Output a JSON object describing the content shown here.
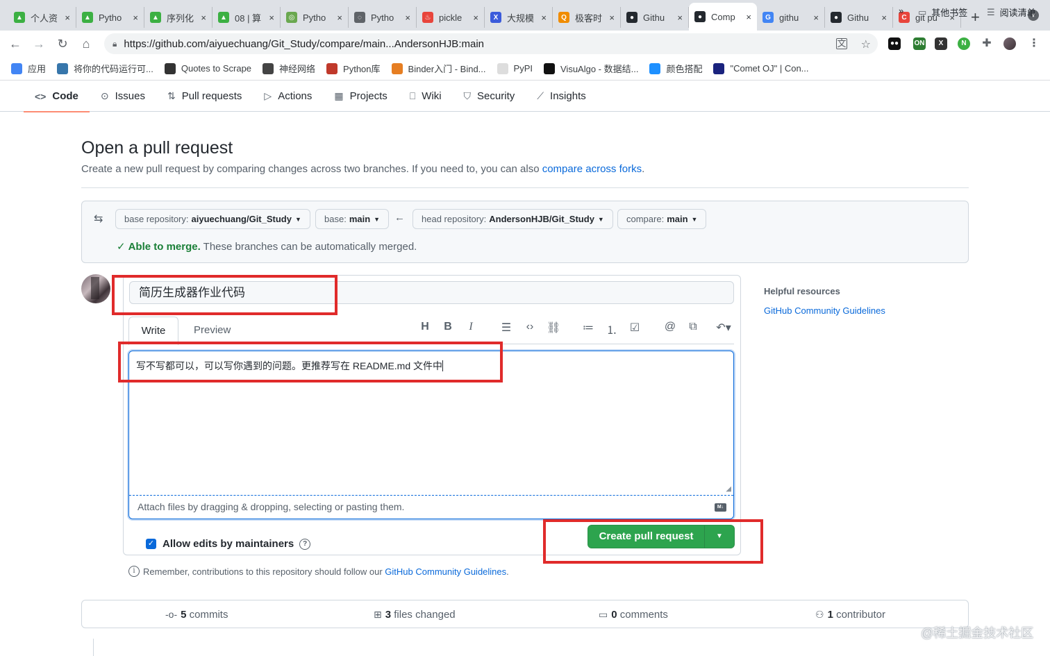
{
  "browser": {
    "tabs": [
      {
        "label": "个人资",
        "color": "#3cb043",
        "glyph": "▲"
      },
      {
        "label": "Pytho",
        "color": "#3cb043",
        "glyph": "▲"
      },
      {
        "label": "序列化",
        "color": "#3cb043",
        "glyph": "▲"
      },
      {
        "label": "08 | 算",
        "color": "#3cb043",
        "glyph": "▲"
      },
      {
        "label": "Pytho",
        "color": "#6aa84f",
        "glyph": "◎"
      },
      {
        "label": "Pytho",
        "color": "#5f6368",
        "glyph": "◌"
      },
      {
        "label": "pickle",
        "color": "#e8453c",
        "glyph": "♨"
      },
      {
        "label": "大规模",
        "color": "#3b5bdb",
        "glyph": "X"
      },
      {
        "label": "极客时",
        "color": "#f08c00",
        "glyph": "Q"
      },
      {
        "label": "Githu",
        "color": "#24292f",
        "glyph": "●"
      },
      {
        "label": "Comp",
        "color": "#24292f",
        "glyph": "●"
      },
      {
        "label": "githu",
        "color": "#4285f4",
        "glyph": "G"
      },
      {
        "label": "Githu",
        "color": "#24292f",
        "glyph": "●"
      },
      {
        "label": "git pu",
        "color": "#e8453c",
        "glyph": "C"
      }
    ],
    "active_tab_index": 10,
    "tab_close": "×",
    "new_tab": "+",
    "url_main": "https://github.com/aiyuechuang/Git_Study/compare/main...AndersonHJB:main",
    "bookmarks": [
      {
        "label": "应用",
        "color": "#4285f4"
      },
      {
        "label": "将你的代码运行可...",
        "color": "#3776ab"
      },
      {
        "label": "Quotes to Scrape",
        "color": "#333333"
      },
      {
        "label": "神经网络",
        "color": "#444444"
      },
      {
        "label": "Python库",
        "color": "#c0392b"
      },
      {
        "label": "Binder入门 - Bind...",
        "color": "#e67e22"
      },
      {
        "label": "PyPI",
        "color": "#dddddd"
      },
      {
        "label": "VisuAlgo - 数据结...",
        "color": "#111111"
      },
      {
        "label": "颜色搭配",
        "color": "#1e90ff"
      },
      {
        "label": "\"Comet OJ\" | Con...",
        "color": "#1a237e"
      }
    ],
    "bookmarks_more": "»",
    "other_bookmarks": "其他书签",
    "reading_list": "阅读清单"
  },
  "repo_nav": [
    {
      "label": "Code",
      "icon": "code-icon",
      "glyph": "<>",
      "selected": true
    },
    {
      "label": "Issues",
      "icon": "issue-icon",
      "glyph": "⊙",
      "selected": false
    },
    {
      "label": "Pull requests",
      "icon": "pull-request-icon",
      "glyph": "⇅",
      "selected": false
    },
    {
      "label": "Actions",
      "icon": "actions-icon",
      "glyph": "▷",
      "selected": false
    },
    {
      "label": "Projects",
      "icon": "projects-icon",
      "glyph": "▦",
      "selected": false
    },
    {
      "label": "Wiki",
      "icon": "wiki-icon",
      "glyph": "⎕",
      "selected": false
    },
    {
      "label": "Security",
      "icon": "shield-icon",
      "glyph": "⛉",
      "selected": false
    },
    {
      "label": "Insights",
      "icon": "graph-icon",
      "glyph": "⟋",
      "selected": false
    }
  ],
  "page": {
    "title": "Open a pull request",
    "subtitle_prefix": "Create a new pull request by comparing changes across two branches. If you need to, you can also ",
    "subtitle_link": "compare across forks",
    "subtitle_suffix": "."
  },
  "range": {
    "base_repo_label": "base repository:",
    "base_repo_value": "aiyuechuang/Git_Study",
    "base_label": "base:",
    "base_value": "main",
    "head_repo_label": "head repository:",
    "head_repo_value": "AndersonHJB/Git_Study",
    "compare_label": "compare:",
    "compare_value": "main",
    "merge_status": "Able to merge.",
    "merge_detail": "These branches can be automatically merged."
  },
  "form": {
    "title_value": "简历生成器作业代码",
    "tab_write": "Write",
    "tab_preview": "Preview",
    "body_value": "写不写都可以，可以写你遇到的问题。更推荐写在 README.md 文件中",
    "attach_hint": "Attach files by dragging & dropping, selecting or pasting them.",
    "allow_edits": "Allow edits by maintainers",
    "create_button": "Create pull request",
    "remember_prefix": "Remember, contributions to this repository should follow our ",
    "remember_link": "GitHub Community Guidelines",
    "remember_suffix": "."
  },
  "sidebar": {
    "heading": "Helpful resources",
    "link": "GitHub Community Guidelines"
  },
  "stats": {
    "commits_count": "5",
    "commits_label": "commits",
    "files_count": "3",
    "files_label": "files changed",
    "comments_count": "0",
    "comments_label": "comments",
    "contributors_count": "1",
    "contributors_label": "contributor"
  },
  "watermark": "@稀土掘金技术社区",
  "annotation_color": "#e02b2b",
  "accent_green": "#2da44e",
  "link_blue": "#0969da"
}
